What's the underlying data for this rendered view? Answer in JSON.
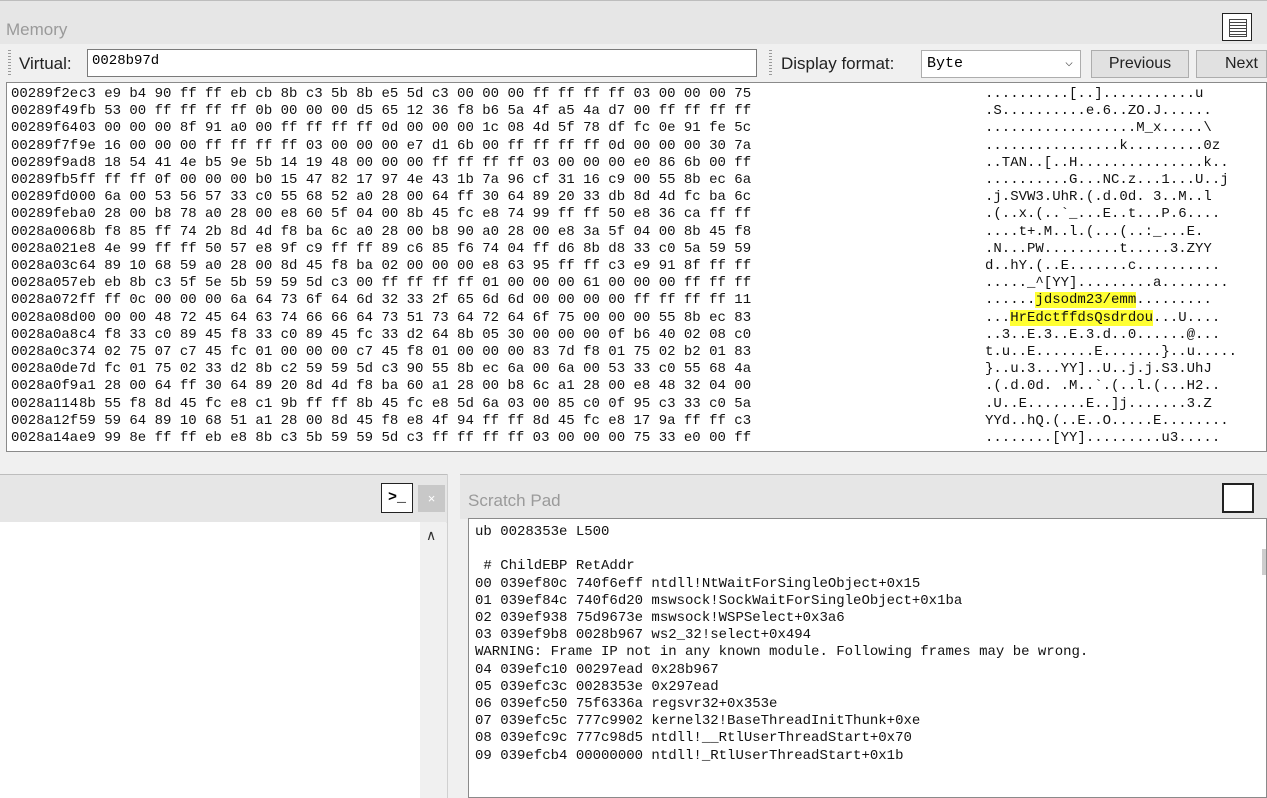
{
  "memory": {
    "title": "Memory",
    "virtual_label": "Virtual:",
    "virtual_value": "0028b97d",
    "display_format_label": "Display format:",
    "display_format_value": "Byte",
    "previous_label": "Previous",
    "next_label": "Next",
    "rows": [
      {
        "addr": "00289f2e",
        "hex": "c3 e9 b4 90 ff ff eb cb 8b c3 5b 8b e5 5d c3 00 00 00 ff ff ff ff 03 00 00 00 75",
        "ascii": "..........[..]...........u"
      },
      {
        "addr": "00289f49",
        "hex": "fb 53 00 ff ff ff ff 0b 00 00 00 d5 65 12 36 f8 b6 5a 4f a5 4a d7 00 ff ff ff ff",
        "ascii": ".S..........e.6..ZO.J......"
      },
      {
        "addr": "00289f64",
        "hex": "03 00 00 00 8f 91 a0 00 ff ff ff ff 0d 00 00 00 1c 08 4d 5f 78 df fc 0e 91 fe 5c",
        "ascii": "..................M_x.....\\"
      },
      {
        "addr": "00289f7f",
        "hex": "9e 16 00 00 00 ff ff ff ff 03 00 00 00 e7 d1 6b 00 ff ff ff ff 0d 00 00 00 30 7a",
        "ascii": "................k.........0z"
      },
      {
        "addr": "00289f9a",
        "hex": "d8 18 54 41 4e b5 9e 5b 14 19 48 00 00 00 ff ff ff ff 03 00 00 00 e0 86 6b 00 ff",
        "ascii": "..TAN..[..H...............k.."
      },
      {
        "addr": "00289fb5",
        "hex": "ff ff ff 0f 00 00 00 b0 15 47 82 17 97 4e 43 1b 7a 96 cf 31 16 c9 00 55 8b ec 6a",
        "ascii": "..........G...NC.z...1...U..j"
      },
      {
        "addr": "00289fd0",
        "hex": "00 6a 00 53 56 57 33 c0 55 68 52 a0 28 00 64 ff 30 64 89 20 33 db 8d 4d fc ba 6c",
        "ascii": ".j.SVW3.UhR.(.d.0d. 3..M..l"
      },
      {
        "addr": "00289feb",
        "hex": "a0 28 00 b8 78 a0 28 00 e8 60 5f 04 00 8b 45 fc e8 74 99 ff ff 50 e8 36 ca ff ff",
        "ascii": ".(..x.(..`_...E..t...P.6...."
      },
      {
        "addr": "0028a006",
        "hex": "8b f8 85 ff 74 2b 8d 4d f8 ba 6c a0 28 00 b8 90 a0 28 00 e8 3a 5f 04 00 8b 45 f8",
        "ascii": "....t+.M..l.(...(..:_...E."
      },
      {
        "addr": "0028a021",
        "hex": "e8 4e 99 ff ff 50 57 e8 9f c9 ff ff 89 c6 85 f6 74 04 ff d6 8b d8 33 c0 5a 59 59",
        "ascii": ".N...PW.........t.....3.ZYY"
      },
      {
        "addr": "0028a03c",
        "hex": "64 89 10 68 59 a0 28 00 8d 45 f8 ba 02 00 00 00 e8 63 95 ff ff c3 e9 91 8f ff ff",
        "ascii": "d..hY.(..E.......c.........."
      },
      {
        "addr": "0028a057",
        "hex": "eb eb 8b c3 5f 5e 5b 59 59 5d c3 00 ff ff ff ff 01 00 00 00 61 00 00 00 ff ff ff",
        "ascii": "....._^[YY].........a........"
      },
      {
        "addr": "0028a072",
        "hex": "ff ff 0c 00 00 00 6a 64 73 6f 64 6d 32 33 2f 65 6d 6d 00 00 00 00 ff ff ff ff 11",
        "ascii": "......jdsodm23/emm........."
      },
      {
        "addr": "0028a08d",
        "hex": "00 00 00 48 72 45 64 63 74 66 66 64 73 51 73 64 72 64 6f 75 00 00 00 55 8b ec 83",
        "ascii": "...HrEdctffdsQsdrdou...U...."
      },
      {
        "addr": "0028a0a8",
        "hex": "c4 f8 33 c0 89 45 f8 33 c0 89 45 fc 33 d2 64 8b 05 30 00 00 00 0f b6 40 02 08 c0",
        "ascii": "..3..E.3..E.3.d..0......@..."
      },
      {
        "addr": "0028a0c3",
        "hex": "74 02 75 07 c7 45 fc 01 00 00 00 c7 45 f8 01 00 00 00 83 7d f8 01 75 02 b2 01 83",
        "ascii": "t.u..E.......E.......}..u....."
      },
      {
        "addr": "0028a0de",
        "hex": "7d fc 01 75 02 33 d2 8b c2 59 59 5d c3 90 55 8b ec 6a 00 6a 00 53 33 c0 55 68 4a",
        "ascii": "}..u.3...YY]..U..j.j.S3.UhJ"
      },
      {
        "addr": "0028a0f9",
        "hex": "a1 28 00 64 ff 30 64 89 20 8d 4d f8 ba 60 a1 28 00 b8 6c a1 28 00 e8 48 32 04 00",
        "ascii": ".(.d.0d. .M..`.(..l.(...H2.."
      },
      {
        "addr": "0028a114",
        "hex": "8b 55 f8 8d 45 fc e8 c1 9b ff ff 8b 45 fc e8 5d 6a 03 00 85 c0 0f 95 c3 33 c0 5a",
        "ascii": ".U..E.......E..]j.......3.Z"
      },
      {
        "addr": "0028a12f",
        "hex": "59 59 64 89 10 68 51 a1 28 00 8d 45 f8 e8 4f 94 ff ff 8d 45 fc e8 17 9a ff ff c3",
        "ascii": "YYd..hQ.(..E..O.....E........"
      },
      {
        "addr": "0028a14a",
        "hex": "e9 99 8e ff ff eb e8 8b c3 5b 59 59 5d c3 ff ff ff ff 03 00 00 00 75 33 e0 00 ff",
        "ascii": "........[YY].........u3....."
      }
    ]
  },
  "scratch_pad": {
    "title": "Scratch Pad",
    "lines": [
      "ub 0028353e L500",
      "",
      " # ChildEBP RetAddr",
      "00 039ef80c 740f6eff ntdll!NtWaitForSingleObject+0x15",
      "01 039ef84c 740f6d20 mswsock!SockWaitForSingleObject+0x1ba",
      "02 039ef938 75d9673e mswsock!WSPSelect+0x3a6",
      "03 039ef9b8 0028b967 ws2_32!select+0x494",
      "WARNING: Frame IP not in any known module. Following frames may be wrong.",
      "04 039efc10 00297ead 0x28b967",
      "05 039efc3c 0028353e 0x297ead",
      "06 039efc50 75f6336a regsvr32+0x353e",
      "07 039efc5c 777c9902 kernel32!BaseThreadInitThunk+0xe",
      "08 039efc9c 777c98d5 ntdll!__RtlUserThreadStart+0x70",
      "09 039efcb4 00000000 ntdll!_RtlUserThreadStart+0x1b"
    ]
  },
  "command": {
    "prompt_icon": "prompt-icon",
    "close_glyph": "×"
  },
  "highlight": {
    "color": "#ffff33",
    "text_1": "jdsodm23/emm",
    "text_2": "HrEdctffdsQsdrdou"
  }
}
